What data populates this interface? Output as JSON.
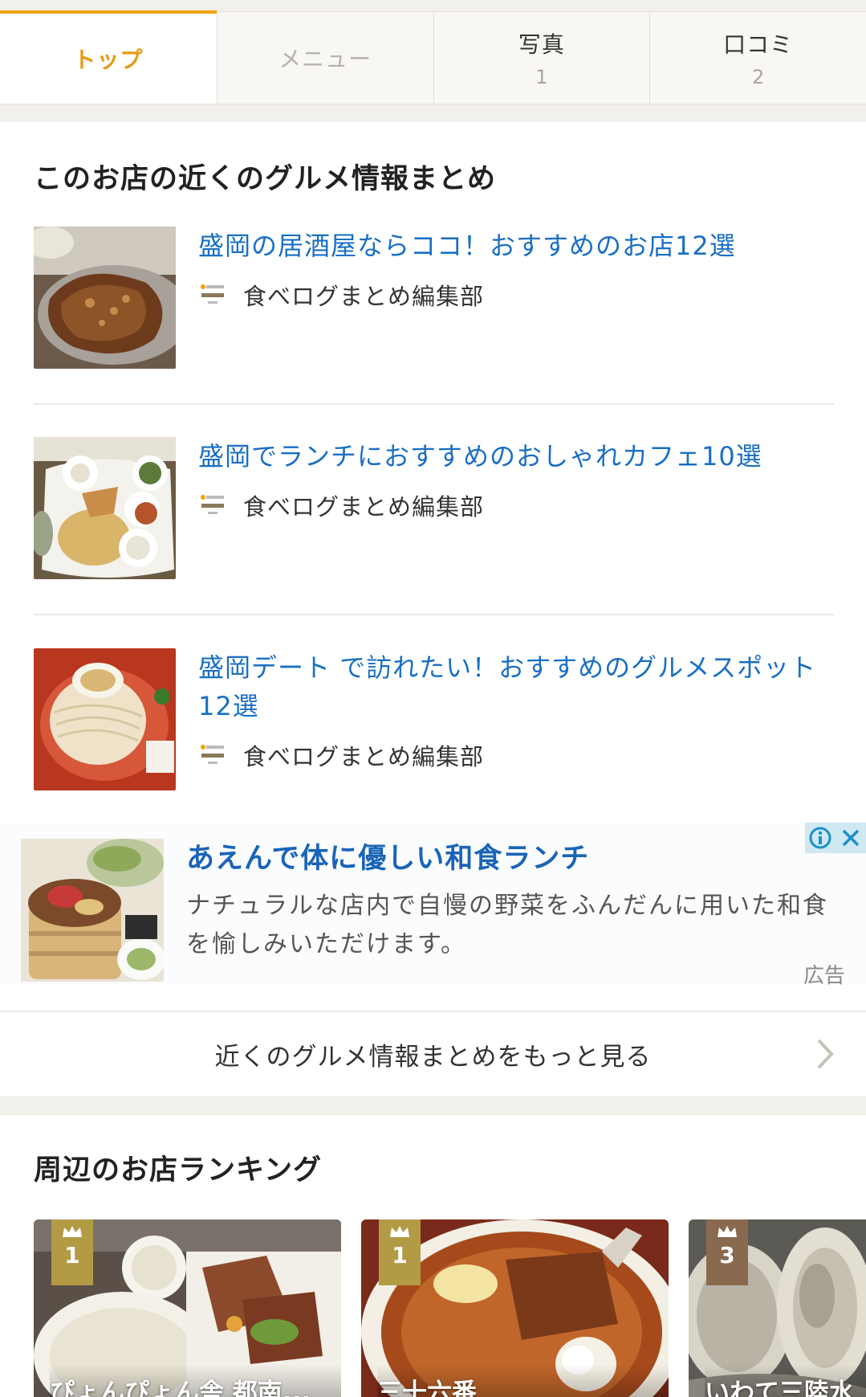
{
  "tabs": [
    {
      "label": "トップ",
      "count": ""
    },
    {
      "label": "メニュー",
      "count": ""
    },
    {
      "label": "写真",
      "count": "1"
    },
    {
      "label": "口コミ",
      "count": "2"
    }
  ],
  "gourmet_section": {
    "title": "このお店の近くのグルメ情報まとめ",
    "articles": [
      {
        "title": "盛岡の居酒屋ならココ！おすすめのお店12選",
        "author": "食べログまとめ編集部",
        "thumb_icon": "grilled-meat-photo"
      },
      {
        "title": "盛岡でランチにおすすめのおしゃれカフェ10選",
        "author": "食べログまとめ編集部",
        "thumb_icon": "cafe-lunch-plate-photo"
      },
      {
        "title": "盛岡デート で訪れたい！おすすめのグルメスポット12選",
        "author": "食べログまとめ編集部",
        "thumb_icon": "cold-noodles-photo"
      }
    ],
    "author_logo_icon": "tabelog-matome-logo-icon",
    "more_label": "近くのグルメ情報まとめをもっと見る"
  },
  "ad": {
    "title": "あえんで体に優しい和食ランチ",
    "description": "ナチュラルな店内で自慢の野菜をふんだんに用いた和食を愉しみいただけます。",
    "label": "広告",
    "thumb_icon": "japanese-lunch-photo"
  },
  "ranking_section": {
    "title": "周辺のお店ランキング",
    "cards": [
      {
        "rank": "1",
        "name": "ぴょんぴょん舎 都南...",
        "badge_color": "#b39a45"
      },
      {
        "rank": "1",
        "name": "三十六番",
        "badge_color": "#b39a45"
      },
      {
        "rank": "3",
        "name": "いわて三陸水",
        "badge_color": "#8a6a4f"
      }
    ]
  },
  "colors": {
    "accent": "#f0a30a",
    "link": "#1a6fc4"
  }
}
